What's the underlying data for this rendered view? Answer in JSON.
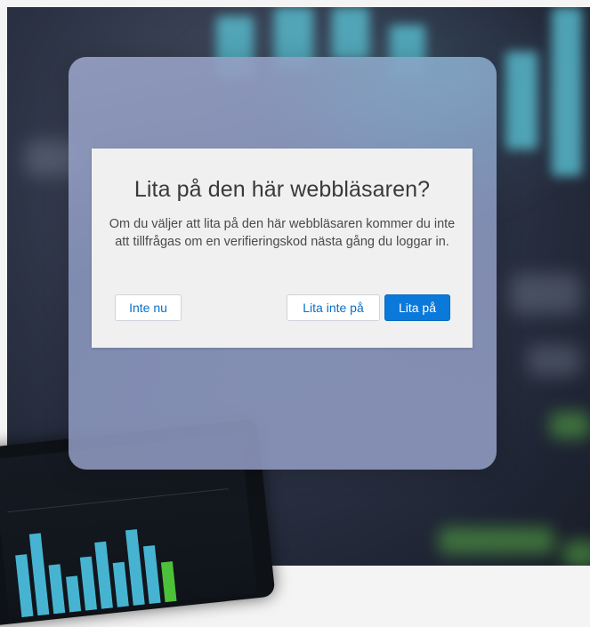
{
  "dialog": {
    "title": "Lita på den här webbläsaren?",
    "message": "Om du väljer att lita på den här webbläsaren kommer du inte att tillfrågas om en verifieringskod nästa gång du loggar in.",
    "buttons": {
      "not_now": "Inte nu",
      "dont_trust": "Lita inte på",
      "trust": "Lita på"
    }
  },
  "colors": {
    "primary_button": "#0b79d9",
    "link_text": "#0a70c7",
    "dialog_background": "#f0f0f1"
  }
}
